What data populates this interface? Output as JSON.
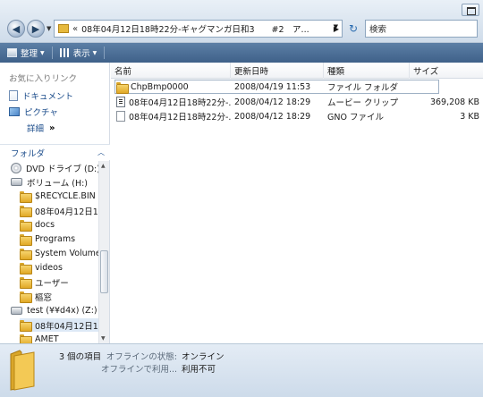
{
  "address": {
    "path": "08年04月12日18時22分-ギャグマンガ日和3　　#2　ア..."
  },
  "search": {
    "placeholder": "検索"
  },
  "toolbar": {
    "organize_label": "整理",
    "views_label": "表示"
  },
  "favorites": {
    "header": "お気に入りリンク",
    "items": [
      {
        "label": "ドキュメント",
        "icon": "document-icon"
      },
      {
        "label": "ピクチャ",
        "icon": "picture-icon"
      }
    ],
    "more_label": "詳細",
    "more_glyph": "»"
  },
  "folders": {
    "header": "フォルダ",
    "tree": [
      {
        "label": "DVD ドライブ (D:)",
        "icon": "disc-icon",
        "indent": 0,
        "selected": false
      },
      {
        "label": "ボリューム (H:)",
        "icon": "drive-icon",
        "indent": 0,
        "selected": false
      },
      {
        "label": "$RECYCLE.BIN",
        "icon": "folder-icon",
        "indent": 1,
        "selected": false
      },
      {
        "label": "08年04月12日18時",
        "icon": "folder-icon",
        "indent": 1,
        "selected": false
      },
      {
        "label": "docs",
        "icon": "folder-icon",
        "indent": 1,
        "selected": false
      },
      {
        "label": "Programs",
        "icon": "folder-icon",
        "indent": 1,
        "selected": false
      },
      {
        "label": "System Volume",
        "icon": "folder-icon",
        "indent": 1,
        "selected": false
      },
      {
        "label": "videos",
        "icon": "folder-icon",
        "indent": 1,
        "selected": false
      },
      {
        "label": "ユーザー",
        "icon": "folder-icon",
        "indent": 1,
        "selected": false
      },
      {
        "label": "樞窓",
        "icon": "folder-icon",
        "indent": 1,
        "selected": false
      },
      {
        "label": "test (¥¥d4x) (Z:)",
        "icon": "drive-icon",
        "indent": 0,
        "selected": false
      },
      {
        "label": "08年04月12日18時",
        "icon": "folder-icon",
        "indent": 1,
        "selected": true
      },
      {
        "label": "AMET",
        "icon": "folder-icon",
        "indent": 1,
        "selected": false
      }
    ]
  },
  "columns": {
    "name": "名前",
    "date": "更新日時",
    "type": "種類",
    "size": "サイズ"
  },
  "files": [
    {
      "name": "ChpBmp0000",
      "date": "2008/04/19 11:53",
      "type": "ファイル フォルダ",
      "size": "",
      "icon": "folder-icon"
    },
    {
      "name": "08年04月12日18時22分-...",
      "date": "2008/04/12 18:29",
      "type": "ムービー クリップ",
      "size": "369,208 KB",
      "icon": "video-file-icon"
    },
    {
      "name": "08年04月12日18時22分-...",
      "date": "2008/04/12 18:29",
      "type": "GNO ファイル",
      "size": "3 KB",
      "icon": "file-icon"
    }
  ],
  "details": {
    "count": "3 個の項目",
    "offline_status_label": "オフラインの状態:",
    "offline_status_value": "オンライン",
    "offline_avail_label": "オフラインで利用...",
    "offline_avail_value": "利用不可"
  }
}
